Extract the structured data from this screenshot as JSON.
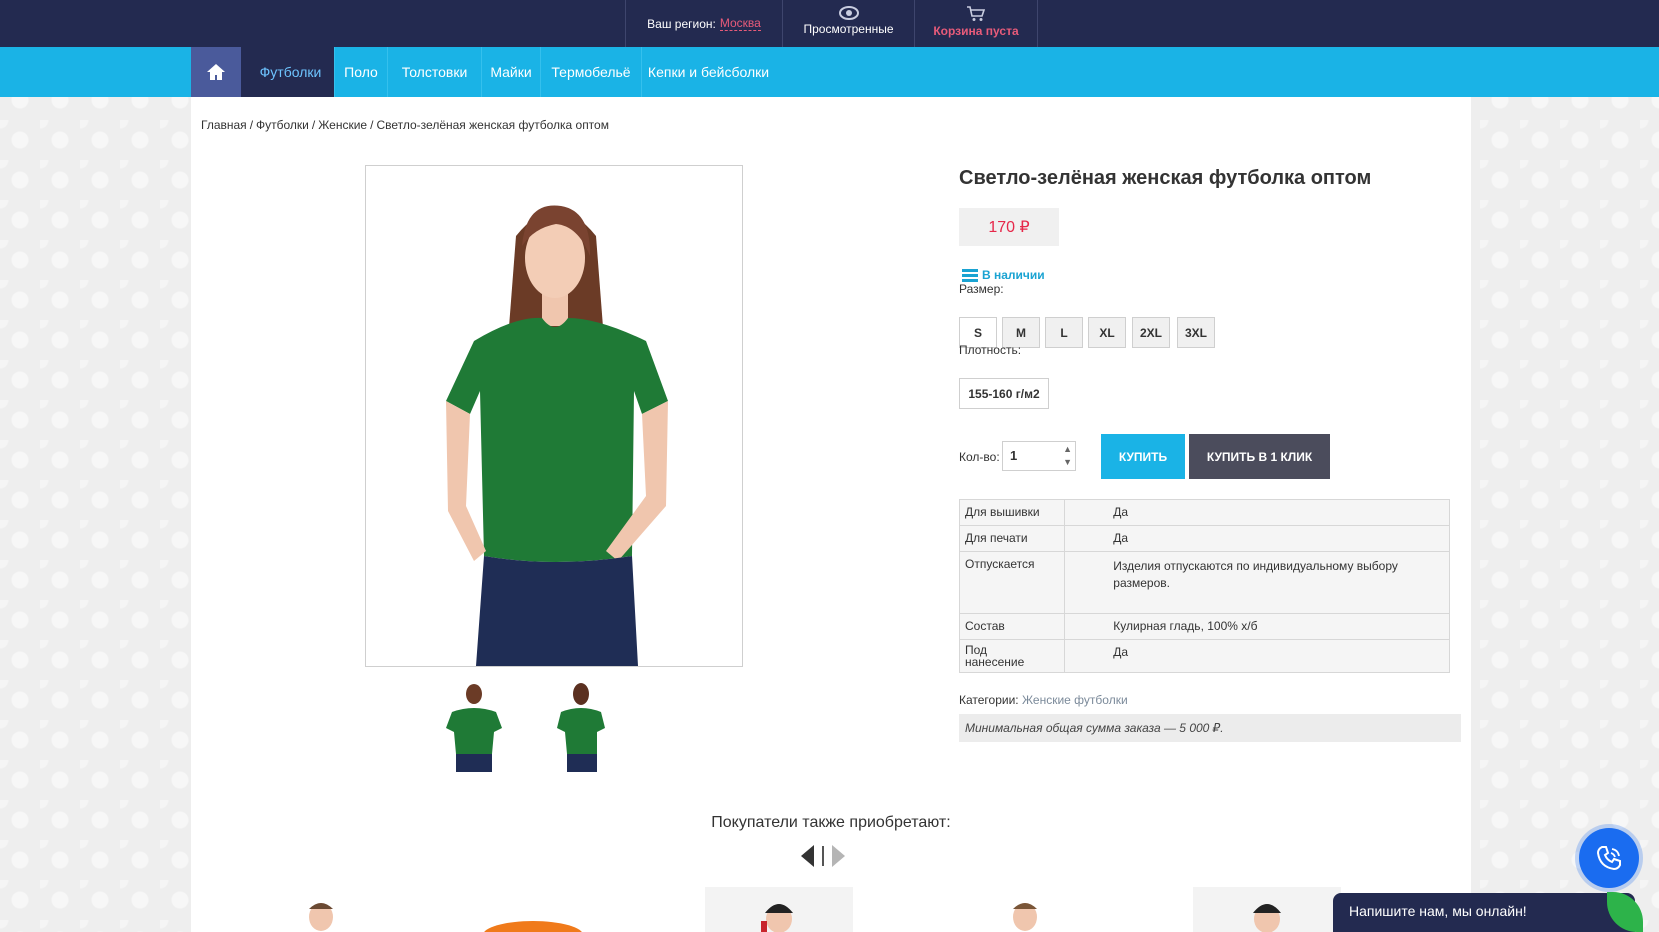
{
  "header": {
    "region_label": "Ваш регион:",
    "region_city": "Москва",
    "viewed_label": "Просмотренные",
    "cart_label": "Корзина пуста"
  },
  "nav": {
    "home_icon": "home-icon",
    "items": [
      {
        "label": "Футболки",
        "active": true
      },
      {
        "label": "Поло"
      },
      {
        "label": "Толстовки"
      },
      {
        "label": "Майки"
      },
      {
        "label": "Термобельё"
      },
      {
        "label": "Кепки и бейсболки"
      }
    ]
  },
  "breadcrumb": [
    "Главная",
    "Футболки",
    "Женские",
    "Светло-зелёная женская футболка оптом"
  ],
  "product": {
    "title": "Светло-зелёная женская футболка оптом",
    "price": "170 ₽",
    "stock": "В наличии",
    "size_label": "Размер:",
    "sizes": [
      "S",
      "M",
      "L",
      "XL",
      "2XL",
      "3XL"
    ],
    "selected_size": "S",
    "density_label": "Плотность:",
    "density_value": "155-160 г/м2",
    "qty_label": "Кол-во:",
    "qty_value": "1",
    "buy_label": "КУПИТЬ",
    "one_click_label": "КУПИТЬ В 1 КЛИК",
    "properties": [
      {
        "key": "Для вышивки",
        "value": "Да"
      },
      {
        "key": "Для печати",
        "value": "Да"
      },
      {
        "key": "Отпускается",
        "value": "Изделия отпускаются по индивидуальному выбору размеров."
      },
      {
        "key": "Состав",
        "value": "Кулирная гладь, 100% х/б"
      },
      {
        "key": "Под нанесение",
        "value": "Да"
      }
    ],
    "categories_label": "Категории:",
    "category_link": "Женские футболки",
    "min_order": "Минимальная общая сумма заказа — 5 000 ₽."
  },
  "also_bought": {
    "title": "Покупатели также приобретают:"
  },
  "chat": {
    "label": "Напишите нам, мы онлайн!"
  },
  "colors": {
    "topbar": "#232a50",
    "navbar": "#1ab3e6",
    "price": "#e6284a",
    "accent_pink": "#e85b7a",
    "shirt_green": "#1f7a36"
  }
}
